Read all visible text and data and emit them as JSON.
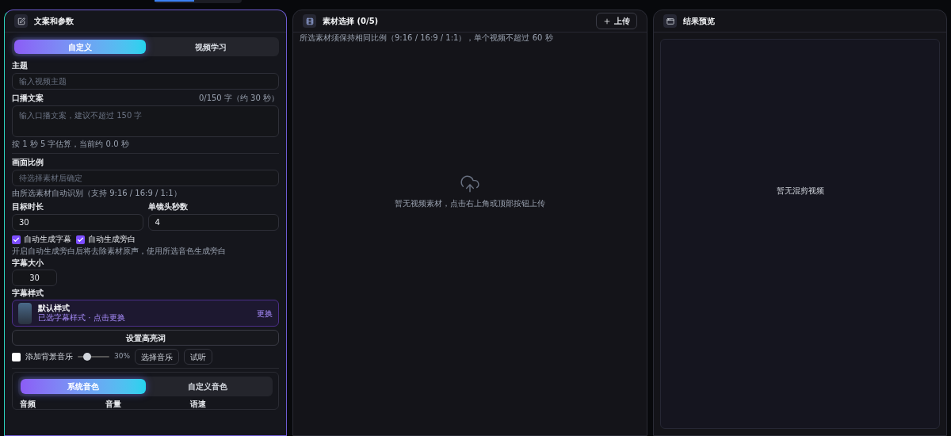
{
  "left_panel": {
    "title": "文案和参数",
    "mode_tabs": [
      {
        "label": "自定义",
        "selected": true
      },
      {
        "label": "视频学习",
        "selected": false
      }
    ],
    "topic": {
      "label": "主题",
      "placeholder": "输入视频主题"
    },
    "script": {
      "label": "口播文案",
      "counter": "0/150 字（约 30 秒）",
      "placeholder": "输入口播文案，建议不超过 150 字",
      "hint": "按 1 秒 5 字估算，当前约 0.0 秒"
    },
    "aspect": {
      "label": "画面比例",
      "placeholder": "待选择素材后确定",
      "hint": "由所选素材自动识别（支持 9:16 / 16:9 / 1:1）"
    },
    "duration": {
      "label": "目标时长",
      "value": "30"
    },
    "shot_seconds": {
      "label": "单镜头秒数",
      "value": "4"
    },
    "toggles": [
      {
        "label": "自动生成字幕",
        "checked": true
      },
      {
        "label": "自动生成旁白",
        "checked": true
      }
    ],
    "toggles_hint": "开启自动生成旁白后将去除素材原声，使用所选音色生成旁白",
    "font_size": {
      "label": "字幕大小",
      "value": "30"
    },
    "subtitle_style": {
      "label": "字幕样式",
      "name": "默认样式",
      "sub": "已选字幕样式 · 点击更换",
      "action": "更换"
    },
    "highlight_button": "设置高亮词",
    "music": {
      "label": "添加背景音乐",
      "checked": false,
      "level": 0.3,
      "reading": "30%",
      "buttons": [
        "选择音乐",
        "试听"
      ]
    },
    "voice": {
      "tabs": [
        {
          "label": "系统音色",
          "selected": true
        },
        {
          "label": "自定义音色",
          "selected": false
        }
      ],
      "fields": [
        "音频",
        "音量",
        "语速"
      ]
    }
  },
  "middle_panel": {
    "title": "素材选择 (0/5)",
    "upload_button": "上传",
    "hint": "所选素材须保持相同比例（9:16 / 16:9 / 1:1），单个视频不超过 60 秒",
    "empty_text": "暂无视频素材，点击右上角或顶部按钮上传"
  },
  "right_panel": {
    "title": "结果预览",
    "empty_text": "暂无混剪视频"
  }
}
